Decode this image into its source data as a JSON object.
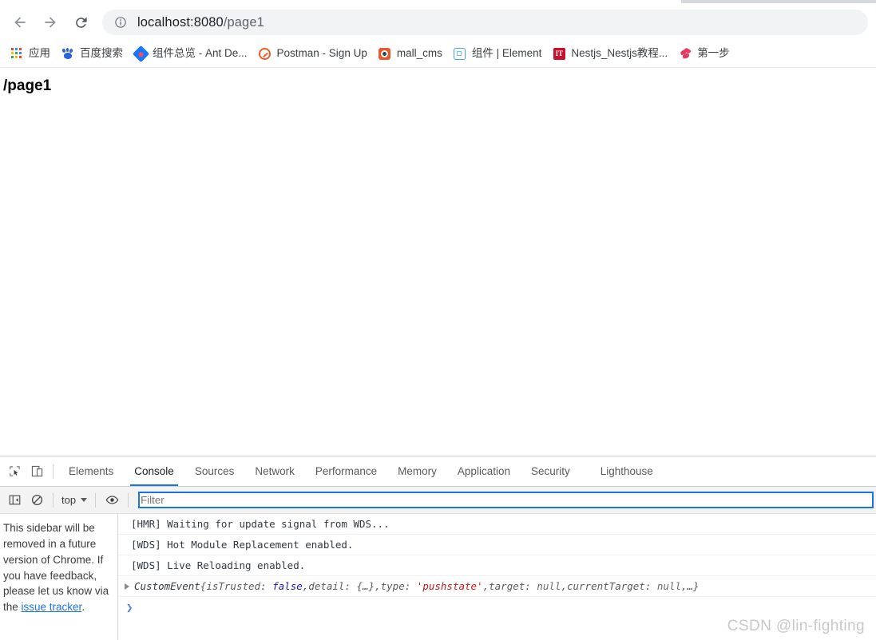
{
  "browser": {
    "nav": {
      "back_label": "Back",
      "forward_label": "Forward",
      "reload_label": "Reload"
    },
    "omnibox": {
      "info_icon": "info-circle-icon",
      "host": "localhost:8080",
      "path": "/page1",
      "full_url": "localhost:8080/page1"
    },
    "bookmarks": [
      {
        "label": "应用",
        "icon": "apps-grid-icon"
      },
      {
        "label": "百度搜索",
        "icon": "baidu-icon"
      },
      {
        "label": "组件总览 - Ant De...",
        "icon": "ant-design-icon"
      },
      {
        "label": "Postman - Sign Up",
        "icon": "postman-icon"
      },
      {
        "label": "mall_cms",
        "icon": "mall-cms-icon"
      },
      {
        "label": "组件 | Element",
        "icon": "element-ui-icon"
      },
      {
        "label": "Nestjs_Nestjs教程...",
        "icon": "nestjs-icon"
      },
      {
        "label": "第一步",
        "icon": "ribbon-icon"
      }
    ]
  },
  "page": {
    "heading": "/page1"
  },
  "devtools": {
    "inspect_icon": "inspect-element-icon",
    "device_icon": "device-toolbar-icon",
    "tabs": [
      {
        "label": "Elements",
        "active": false
      },
      {
        "label": "Console",
        "active": true
      },
      {
        "label": "Sources",
        "active": false
      },
      {
        "label": "Network",
        "active": false
      },
      {
        "label": "Performance",
        "active": false
      },
      {
        "label": "Memory",
        "active": false
      },
      {
        "label": "Application",
        "active": false
      },
      {
        "label": "Security",
        "active": false
      },
      {
        "label": "Lighthouse",
        "active": false
      }
    ],
    "console_toolbar": {
      "sidebar_toggle_icon": "console-sidebar-toggle-icon",
      "clear_icon": "clear-console-icon",
      "context_selector": "top",
      "eye_icon": "live-expression-icon",
      "filter_placeholder": "Filter",
      "filter_value": ""
    },
    "sidebar_notice": {
      "text_before": "This sidebar will be removed in a future version of Chrome. If you have feedback, please let us know via the ",
      "link_label": "issue tracker",
      "text_after": "."
    },
    "messages": [
      {
        "kind": "log",
        "text": "[HMR] Waiting for update signal from WDS..."
      },
      {
        "kind": "log",
        "text": "[WDS] Hot Module Replacement enabled."
      },
      {
        "kind": "log",
        "text": "[WDS] Live Reloading enabled."
      }
    ],
    "object_message": {
      "constructor": "CustomEvent",
      "open_brace": " {",
      "props": [
        {
          "key": "isTrusted:",
          "value": "false",
          "type": "bool",
          "sep": ", "
        },
        {
          "key": "detail:",
          "value": "{…}",
          "type": "obj",
          "sep": ", "
        },
        {
          "key": "type:",
          "value": "'pushstate'",
          "type": "str",
          "sep": ", "
        },
        {
          "key": "target:",
          "value": "null",
          "type": "null",
          "sep": ", "
        },
        {
          "key": "currentTarget:",
          "value": "null",
          "type": "null",
          "sep": ", "
        }
      ],
      "ellipsis": "…}"
    },
    "prompt_chevron": "❯"
  },
  "watermark": "CSDN @lin-fighting",
  "colors": {
    "accent": "#1a73e8",
    "omnibox_bg": "#f1f3f4",
    "string_token": "#c41a16",
    "bool_token": "#1a1aa6"
  }
}
